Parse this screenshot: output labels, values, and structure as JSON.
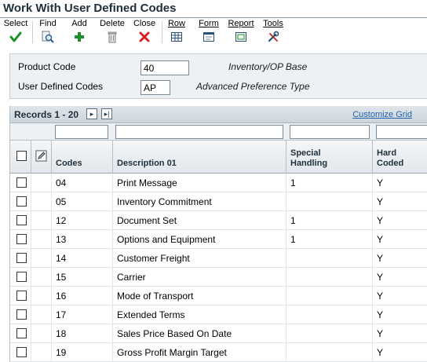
{
  "window": {
    "title": "Work With User Defined Codes"
  },
  "toolbar": {
    "select": "Select",
    "find": "Find",
    "add": "Add",
    "delete": "Delete",
    "close": "Close",
    "row": "Row",
    "form": "Form",
    "report": "Report",
    "tools": "Tools"
  },
  "header": {
    "product_code_label": "Product Code",
    "product_code_value": "40",
    "product_code_desc": "Inventory/OP Base",
    "udc_label": "User Defined Codes",
    "udc_value": "AP",
    "udc_desc": "Advanced Preference Type"
  },
  "grid": {
    "records_label": "Records 1 - 20",
    "next_icon": "next-page-icon",
    "last_icon": "last-page-icon",
    "customize_label": "Customize Grid",
    "columns": {
      "codes": "Codes",
      "description": "Description 01",
      "special_handling": "Special Handling",
      "hard_coded": "Hard Coded"
    },
    "rows": [
      {
        "code": "04",
        "description": "Print Message",
        "special": "1",
        "hard": "Y"
      },
      {
        "code": "05",
        "description": "Inventory Commitment",
        "special": "",
        "hard": "Y"
      },
      {
        "code": "12",
        "description": "Document Set",
        "special": "1",
        "hard": "Y"
      },
      {
        "code": "13",
        "description": "Options and Equipment",
        "special": "1",
        "hard": "Y"
      },
      {
        "code": "14",
        "description": "Customer Freight",
        "special": "",
        "hard": "Y"
      },
      {
        "code": "15",
        "description": "Carrier",
        "special": "",
        "hard": "Y"
      },
      {
        "code": "16",
        "description": "Mode of Transport",
        "special": "",
        "hard": "Y"
      },
      {
        "code": "17",
        "description": "Extended Terms",
        "special": "",
        "hard": "Y"
      },
      {
        "code": "18",
        "description": "Sales Price Based On Date",
        "special": "",
        "hard": "Y"
      },
      {
        "code": "19",
        "description": "Gross Profit Margin Target",
        "special": "",
        "hard": "Y"
      }
    ]
  },
  "colors": {
    "title": "#1e2f3a",
    "link": "#1e63b0",
    "check": "#1a8f2a",
    "delete_x": "#d42020"
  }
}
